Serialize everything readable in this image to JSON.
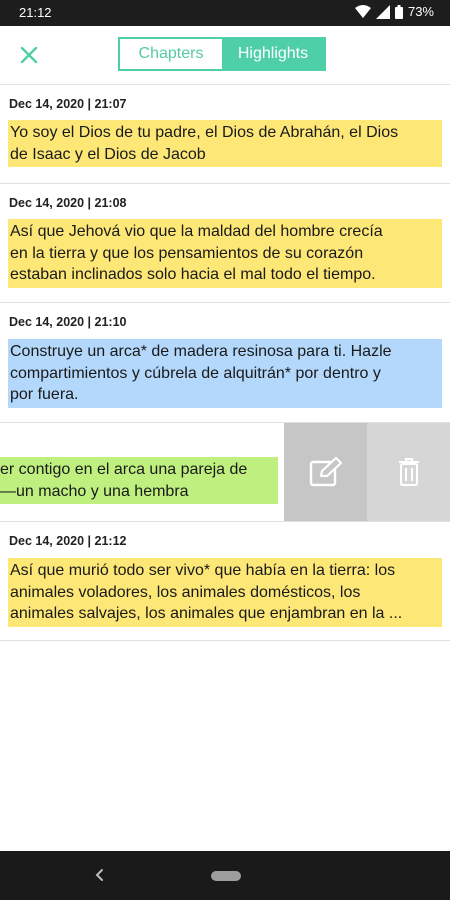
{
  "status_bar": {
    "time": "21:12",
    "battery": "73%"
  },
  "header": {
    "close_icon": "close-icon",
    "tabs": [
      {
        "label": "Chapters",
        "active": false
      },
      {
        "label": "Highlights",
        "active": true
      }
    ],
    "accent_color": "#4fcfa8"
  },
  "highlights": [
    {
      "date": "Dec 14, 2020 | 21:07",
      "color": "#fde777",
      "lines": [
        "Yo soy el Dios de tu padre, el Dios de Abrahán, el Dios",
        "de Isaac y el Dios de Jacob"
      ]
    },
    {
      "date": "Dec 14, 2020 | 21:08",
      "color": "#fde777",
      "lines": [
        "Así que Jehová vio que la maldad del hombre crecía",
        "en la tierra y que los pensamientos de su corazón",
        "estaban inclinados solo hacia el mal todo el tiempo."
      ]
    },
    {
      "date": "Dec 14, 2020 | 21:10",
      "color": "#b3d8fb",
      "lines": [
        "Construye un arca* de madera resinosa para ti. Hazle",
        "compartimientos y cúbrela de alquitrán* por dentro y",
        "por fuera."
      ]
    },
    {
      "date": "",
      "color": "#bff07f",
      "swiped": true,
      "lines": [
        "er contigo en el arca una pareja de",
        "—un macho y una hembra"
      ],
      "actions": [
        {
          "icon": "edit-icon"
        },
        {
          "icon": "trash-icon"
        }
      ]
    },
    {
      "date": "Dec 14, 2020 | 21:12",
      "color": "#fde777",
      "lines": [
        "Así que murió todo ser vivo* que había en la tierra: los",
        "animales voladores, los animales domésticos, los",
        "animales salvajes, los animales que enjambran en la ..."
      ]
    }
  ],
  "nav_bar": {
    "back_icon": "back-icon",
    "home_icon": "home-pill-icon"
  }
}
